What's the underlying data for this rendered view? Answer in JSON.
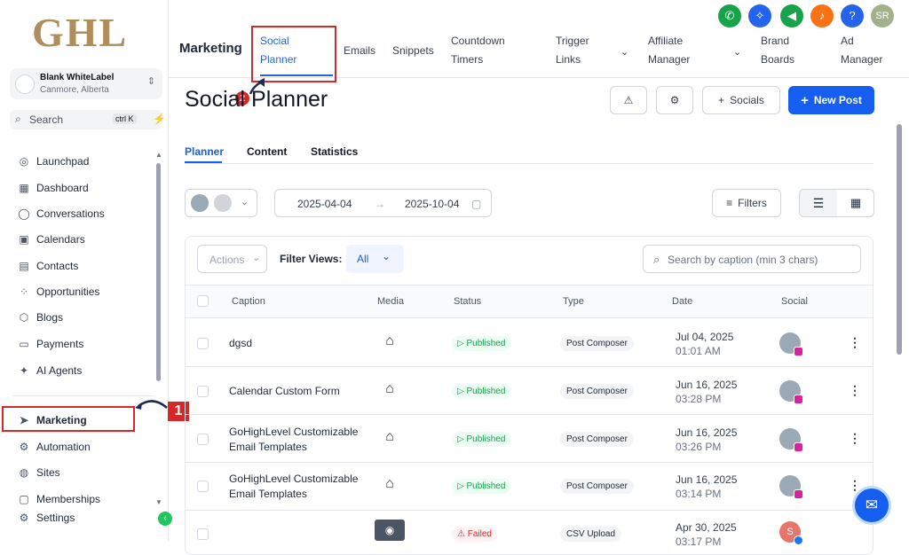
{
  "app": {
    "logo": "GHL"
  },
  "account": {
    "name": "Blank WhiteLabel",
    "location": "Canmore, Alberta"
  },
  "search": {
    "label": "Search",
    "shortcut": "ctrl K"
  },
  "sidebar": {
    "items": [
      {
        "label": "Launchpad",
        "icon": "rocket-icon"
      },
      {
        "label": "Dashboard",
        "icon": "dashboard-icon"
      },
      {
        "label": "Conversations",
        "icon": "chat-icon"
      },
      {
        "label": "Calendars",
        "icon": "calendar-icon"
      },
      {
        "label": "Contacts",
        "icon": "contacts-icon"
      },
      {
        "label": "Opportunities",
        "icon": "opportunities-icon"
      },
      {
        "label": "Blogs",
        "icon": "blog-icon"
      },
      {
        "label": "Payments",
        "icon": "payments-icon"
      },
      {
        "label": "AI Agents",
        "icon": "sparkle-icon"
      },
      {
        "label": "Marketing",
        "icon": "send-icon"
      },
      {
        "label": "Automation",
        "icon": "automation-icon"
      },
      {
        "label": "Sites",
        "icon": "globe-icon"
      },
      {
        "label": "Memberships",
        "icon": "membership-icon"
      },
      {
        "label": "Settings",
        "icon": "gear-icon"
      }
    ]
  },
  "topnav": {
    "section": "Marketing",
    "items": {
      "social_planner": "Social\nPlanner",
      "emails": "Emails",
      "snippets": "Snippets",
      "countdown": "Countdown\nTimers",
      "trigger": "Trigger\nLinks",
      "affiliate": "Affiliate\nManager",
      "brand": "Brand\nBoards",
      "ad": "Ad\nManager"
    }
  },
  "header_icons": {
    "user_initials": "SR",
    "help": "?",
    "colors": {
      "phone": "#16a34a",
      "magic": "#2563eb",
      "megaphone": "#16a34a",
      "bell": "#f97316",
      "help": "#2563eb",
      "user": "#a3b18a"
    }
  },
  "annotations": {
    "step1": "1",
    "step2": "2"
  },
  "page": {
    "title": "Social Planner",
    "socials_button": "Socials",
    "new_post_button": "New Post",
    "tabs": [
      "Planner",
      "Content",
      "Statistics"
    ],
    "date_from": "2025-04-04",
    "date_to": "2025-10-04",
    "filters_button": "Filters"
  },
  "table": {
    "actions_label": "Actions",
    "filter_views_label": "Filter Views:",
    "filter_views_value": "All",
    "search_placeholder": "Search by caption (min 3 chars)",
    "columns": [
      "Caption",
      "Media",
      "Status",
      "Type",
      "Date",
      "Social"
    ],
    "rows": [
      {
        "caption": "dgsd",
        "status": "Published",
        "type": "Post Composer",
        "date": "Jul 04, 2025",
        "time": "01:01 AM"
      },
      {
        "caption": "Calendar Custom Form",
        "status": "Published",
        "type": "Post Composer",
        "date": "Jun 16, 2025",
        "time": "03:28 PM"
      },
      {
        "caption": "GoHighLevel Customizable Email Templates",
        "status": "Published",
        "type": "Post Composer",
        "date": "Jun 16, 2025",
        "time": "03:26 PM"
      },
      {
        "caption": "GoHighLevel Customizable Email Templates",
        "status": "Published",
        "type": "Post Composer",
        "date": "Jun 16, 2025",
        "time": "03:14 PM"
      },
      {
        "caption": "",
        "status": "Failed",
        "type": "CSV Upload",
        "date": "Apr 30, 2025",
        "time": "03:17 PM",
        "avatar": "S"
      }
    ]
  }
}
